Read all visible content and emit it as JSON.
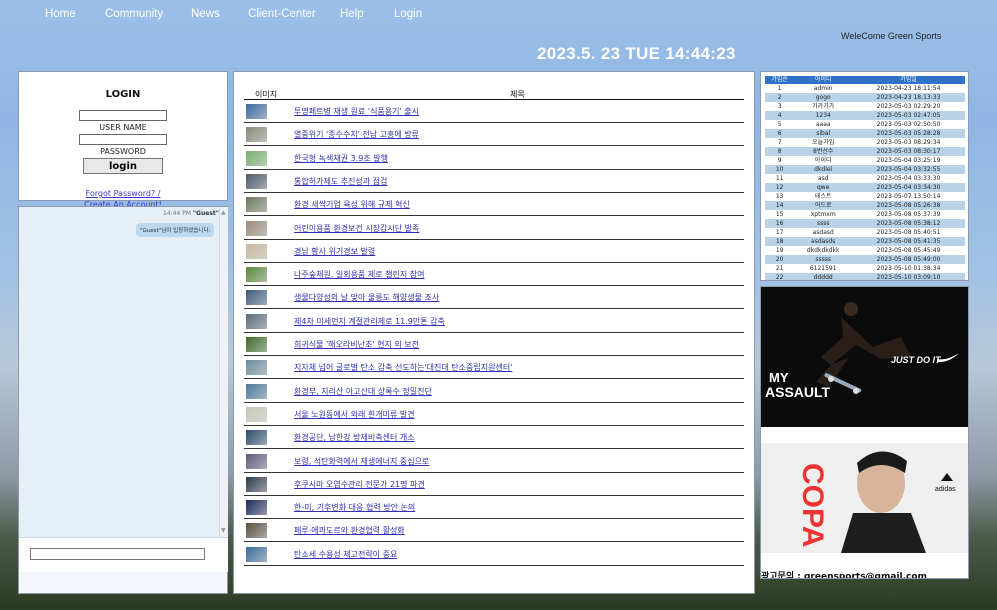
{
  "nav": {
    "home": "Home",
    "community": "Community",
    "news": "News",
    "client": "Client-Center",
    "help": "Help",
    "login": "Login"
  },
  "welcome": "WeleCome Green Sports",
  "clock": "2023.5. 23 TUE 14:44:23",
  "login": {
    "title": "LOGIN",
    "username_label": "USER NAME",
    "password_label": "PASSWORD",
    "button": "login",
    "forgot": "Forgot Password? /",
    "create": "Create An Account!"
  },
  "chat": {
    "time": "14:44 PM",
    "user": "\"Guest\"",
    "message": "\"Guest\"님이 입장하셨습니다."
  },
  "news": {
    "col_image": "이미지",
    "col_title": "제목",
    "items": [
      {
        "title": "투명페트병 재생 원료 '식품용기' 출시",
        "color": "#3b6aa0"
      },
      {
        "title": "열중위기 '종수수치' 전남 고흥에 방류",
        "color": "#8a8a7a"
      },
      {
        "title": "한국형 녹색채권 3.9조 발행",
        "color": "#7ab070"
      },
      {
        "title": "통합허가제도 추진성과 점검",
        "color": "#4a5a6a"
      },
      {
        "title": "환경 새싹기업 육성 위해 규제 혁신",
        "color": "#6a7a5a"
      },
      {
        "title": "어린이용품 환경보건 시장감시단 발족",
        "color": "#9a8a7a"
      },
      {
        "title": "경남 황사 위기경보 발령",
        "color": "#c8b8a0"
      },
      {
        "title": "나주숲체원, 일회용품 제로 챌린지 참여",
        "color": "#5a8a3a"
      },
      {
        "title": "생물다양성의 날 맞아 울릉도 해양생물 조사",
        "color": "#3a5a7a"
      },
      {
        "title": "제4차 미세먼지 계절관리제로 11.9만톤 감축",
        "color": "#5a6a7a"
      },
      {
        "title": "희귀식물 '해오라비난초' 현지 외 보전",
        "color": "#3a6a2a"
      },
      {
        "title": "지자체 넘어 글로벌 탄소 감축 선도하는'대진대 탄소중립지원센터'",
        "color": "#6a8aa0"
      },
      {
        "title": "환경부, 지리산 아고산대 상록수 정밀진단",
        "color": "#4a7a9a"
      },
      {
        "title": "서울 노원동에서 외래 흰개미류 발견",
        "color": "#c8c8b8"
      },
      {
        "title": "환경공단, 남한강 방제비축센터 개소",
        "color": "#2a4a6a"
      },
      {
        "title": "보령, 석탄화력에서 재생에너지 중심으로",
        "color": "#5a5a7a"
      },
      {
        "title": "후쿠시마 오염수관리 전문가 21명 파견",
        "color": "#2a3a4a"
      },
      {
        "title": "한-미, 기후변화 대응 협력 방안 논의",
        "color": "#1a2a5a"
      },
      {
        "title": "페루·에콰도르와 환경협력 활성화",
        "color": "#5a5040"
      },
      {
        "title": "탄소세 수용성 제고전략이 중요",
        "color": "#3a6a9a"
      }
    ]
  },
  "members": {
    "headers": [
      "가입순",
      "아이디",
      "가입일"
    ],
    "rows": [
      [
        "1",
        "admin",
        "2023-04-23 18:11:54"
      ],
      [
        "2",
        "gogo",
        "2023-04-23 18:13:33"
      ],
      [
        "3",
        "가가가가",
        "2023-05-03 02:29:20"
      ],
      [
        "4",
        "1234",
        "2023-05-03 02:47:05"
      ],
      [
        "5",
        "aaaa",
        "2023-05-03 02:50:50"
      ],
      [
        "6",
        "sibal",
        "2023-05-03 05:28:28"
      ],
      [
        "7",
        "오늘가입",
        "2023-05-03 08:29:34"
      ],
      [
        "8",
        "8번선수",
        "2023-05-03 08:30:17"
      ],
      [
        "9",
        "아이디",
        "2023-05-04 03:25:19"
      ],
      [
        "10",
        "dkdlel",
        "2023-05-04 03:32:55"
      ],
      [
        "11",
        "asd",
        "2023-05-04 03:33:30"
      ],
      [
        "12",
        "qwe",
        "2023-05-04 03:34:30"
      ],
      [
        "13",
        "테스트",
        "2023-05-07 13:50:14"
      ],
      [
        "14",
        "어드로",
        "2023-05-08 05:26:38"
      ],
      [
        "15",
        "xptmxm",
        "2023-05-08 05:37:39"
      ],
      [
        "16",
        "ssss",
        "2023-05-08 05:38:12"
      ],
      [
        "17",
        "asdasd",
        "2023-05-08 05:40:51"
      ],
      [
        "18",
        "asdasds",
        "2023-05-08 05:41:35"
      ],
      [
        "19",
        "dkdkdkdkk",
        "2023-05-08 05:45:49"
      ],
      [
        "20",
        "sssss",
        "2023-05-08 05:49:00"
      ],
      [
        "21",
        "6121591",
        "2023-05-10 01:38:34"
      ],
      [
        "22",
        "ddddd",
        "2023-05-10 03:09:10"
      ]
    ]
  },
  "ads": {
    "ad1_text1": "MY",
    "ad1_text2": "ASSAULT",
    "ad1_slogan": "JUST DO IT",
    "ad2_text": "COPA",
    "ad2_brand": "adidas",
    "contact": "광고문의 : greensports@gmail.com"
  }
}
